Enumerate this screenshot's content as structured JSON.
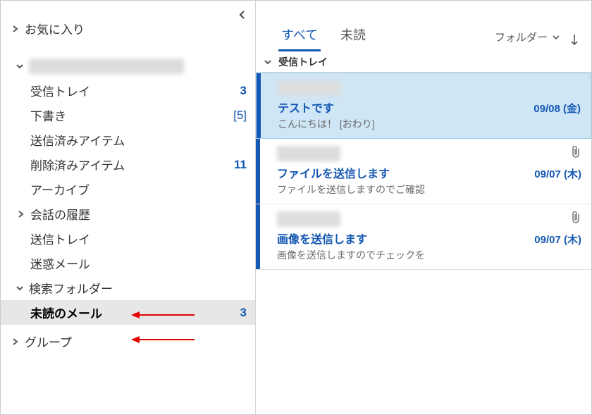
{
  "sidebar": {
    "favorites_label": "お気に入り",
    "account_collapsed": false,
    "folders": {
      "inbox": {
        "label": "受信トレイ",
        "count": "3"
      },
      "drafts": {
        "label": "下書き",
        "count": "[5]"
      },
      "sent": {
        "label": "送信済みアイテム",
        "count": ""
      },
      "deleted": {
        "label": "削除済みアイテム",
        "count": "11"
      },
      "archive": {
        "label": "アーカイブ",
        "count": ""
      },
      "conv": {
        "label": "会話の履歴",
        "count": ""
      },
      "outbox": {
        "label": "送信トレイ",
        "count": ""
      },
      "junk": {
        "label": "迷惑メール",
        "count": ""
      }
    },
    "search_folders_label": "検索フォルダー",
    "unread_folder": {
      "label": "未読のメール",
      "count": "3"
    },
    "groups_label": "グループ"
  },
  "main": {
    "tabs": {
      "all": "すべて",
      "unread": "未読"
    },
    "sort": {
      "label": "フォルダー"
    },
    "section_header": "受信トレイ",
    "messages": [
      {
        "subject": "テストです",
        "date": "09/08 (金)",
        "preview": "こんにちは！  [おわり]",
        "attachment": false,
        "selected": true
      },
      {
        "subject": "ファイルを送信します",
        "date": "09/07 (木)",
        "preview": "ファイルを送信しますのでご確認",
        "attachment": true,
        "selected": false
      },
      {
        "subject": "画像を送信します",
        "date": "09/07 (木)",
        "preview": "画像を送信しますのでチェックを",
        "attachment": true,
        "selected": false
      }
    ]
  }
}
